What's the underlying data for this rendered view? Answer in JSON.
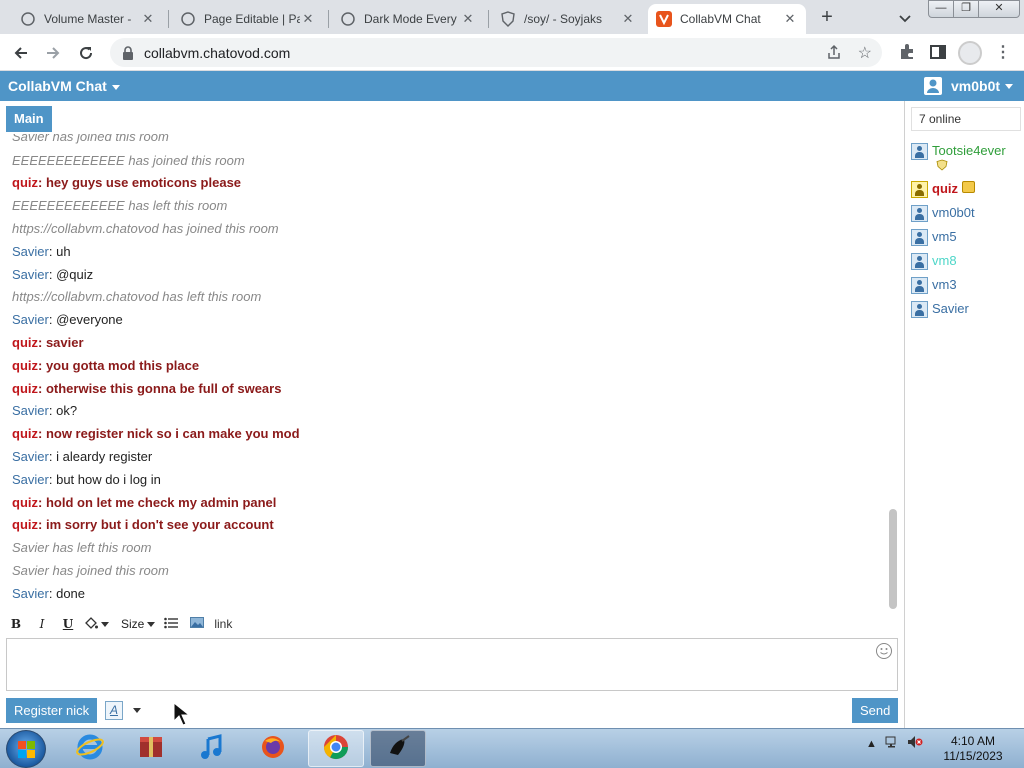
{
  "browser": {
    "tabs": [
      {
        "title": "Volume Master - ",
        "icon": "circle-icon"
      },
      {
        "title": "Page Editable | Pa",
        "icon": "circle-icon"
      },
      {
        "title": "Dark Mode Every",
        "icon": "circle-icon"
      },
      {
        "title": "/soy/ - Soyjaks",
        "icon": "shield-icon"
      },
      {
        "title": "CollabVM Chat",
        "icon": "v-logo-icon"
      }
    ],
    "url": "collabvm.chatovod.com"
  },
  "app": {
    "title": "CollabVM Chat",
    "username": "vm0b0t",
    "room_tab": "Main"
  },
  "messages": [
    {
      "type": "system",
      "text": "Savier has joined this room"
    },
    {
      "type": "system",
      "text": "EEEEEEEEEEEEE has joined this room"
    },
    {
      "type": "mod",
      "nick": "quiz",
      "text": "hey guys use emoticons please"
    },
    {
      "type": "system",
      "text": "EEEEEEEEEEEEE has left this room"
    },
    {
      "type": "system",
      "text": "https://collabvm.chatovod has joined this room"
    },
    {
      "type": "user",
      "nick": "Savier",
      "text": "uh"
    },
    {
      "type": "user",
      "nick": "Savier",
      "text": "@quiz"
    },
    {
      "type": "system",
      "text": "https://collabvm.chatovod has left this room"
    },
    {
      "type": "user",
      "nick": "Savier",
      "text": "@everyone"
    },
    {
      "type": "mod",
      "nick": "quiz",
      "text": "savier"
    },
    {
      "type": "mod",
      "nick": "quiz",
      "text": "you gotta mod this place"
    },
    {
      "type": "mod",
      "nick": "quiz",
      "text": "otherwise this gonna be full of swears"
    },
    {
      "type": "user",
      "nick": "Savier",
      "text": "ok?"
    },
    {
      "type": "mod",
      "nick": "quiz",
      "text": "now register nick so i can make you mod"
    },
    {
      "type": "user",
      "nick": "Savier",
      "text": "i aleardy register"
    },
    {
      "type": "user",
      "nick": "Savier",
      "text": "but how do i log in"
    },
    {
      "type": "mod",
      "nick": "quiz",
      "text": "hold on let me check my admin panel"
    },
    {
      "type": "mod",
      "nick": "quiz",
      "text": "im sorry but i don't see your account"
    },
    {
      "type": "system",
      "text": "Savier has left this room"
    },
    {
      "type": "system",
      "text": "Savier has joined this room"
    },
    {
      "type": "user",
      "nick": "Savier",
      "text": "done"
    }
  ],
  "toolbar": {
    "bold": "B",
    "italic": "I",
    "underline": "U",
    "size": "Size",
    "link": "link"
  },
  "bottom": {
    "register_label": "Register nick",
    "font_label": "A",
    "send_label": "Send"
  },
  "sidebar": {
    "online_count": "7 online",
    "users": [
      {
        "name": "Tootsie4ever",
        "color": "green",
        "badge": "shield-badge-icon"
      },
      {
        "name": "quiz",
        "color": "red",
        "badge": "crown-badge-icon"
      },
      {
        "name": "vm0b0t",
        "color": "blue"
      },
      {
        "name": "vm5",
        "color": "blue"
      },
      {
        "name": "vm8",
        "color": "cyan"
      },
      {
        "name": "vm3",
        "color": "blue"
      },
      {
        "name": "Savier",
        "color": "blue"
      }
    ]
  },
  "taskbar": {
    "time": "4:10 AM",
    "date": "11/15/2023"
  }
}
